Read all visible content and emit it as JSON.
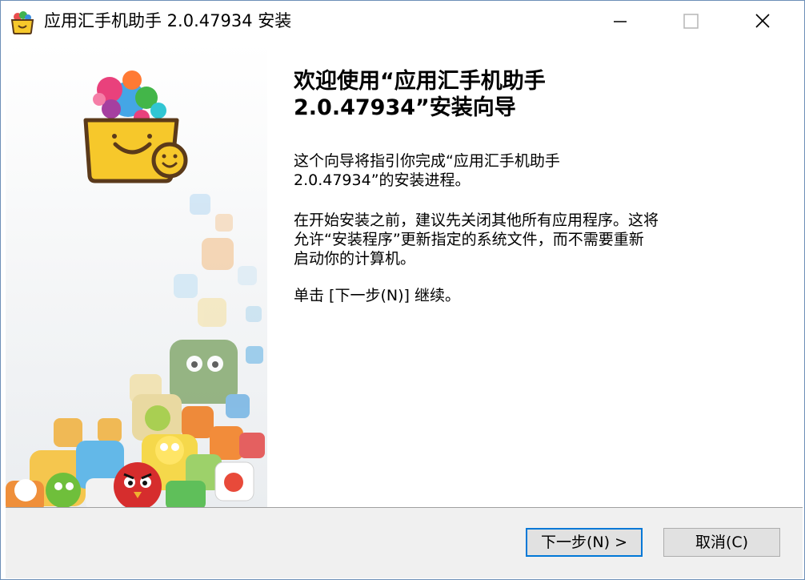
{
  "window": {
    "title": "应用汇手机助手 2.0.47934 安装",
    "minimize_icon": "minimize-icon",
    "maximize_icon": "maximize-icon",
    "close_icon": "close-icon"
  },
  "welcome": {
    "heading_line1": "欢迎使用“应用汇手机助手",
    "heading_line2": "2.0.47934”安装向导",
    "p1_line1": "这个向导将指引你完成“应用汇手机助手",
    "p1_line2": "2.0.47934”的安装进程。",
    "p2_line1": "在开始安装之前，建议先关闭其他所有应用程序。这将",
    "p2_line2": "允许“安装程序”更新指定的系统文件，而不需要重新",
    "p2_line3": "启动你的计算机。",
    "p3": "单击 [下一步(N)] 继续。"
  },
  "buttons": {
    "next": "下一步(N) >",
    "cancel": "取消(C)"
  },
  "colors": {
    "logo_yellow": "#f6c82b",
    "logo_outline": "#5b3a1a",
    "accent_border": "#0078d7"
  },
  "icons": {
    "app": "appchina-basket-icon",
    "side_logo": "appchina-logo-icon"
  }
}
